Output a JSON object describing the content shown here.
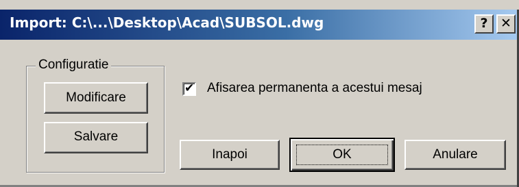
{
  "window": {
    "title": "Import: C:\\...\\Desktop\\Acad\\SUBSOL.dwg",
    "help_button": "?",
    "close_button": "✕"
  },
  "config_group": {
    "label": "Configuratie",
    "modify_label": "Modificare",
    "save_label": "Salvare"
  },
  "checkbox": {
    "checked": true,
    "label": "Afisarea permanenta a acestui mesaj"
  },
  "buttons": {
    "back_label": "Inapoi",
    "ok_label": "OK",
    "cancel_label": "Anulare"
  },
  "colors": {
    "title_gradient_start": "#0a246a",
    "title_gradient_end": "#a6caf0",
    "face": "#d4d0c8"
  }
}
